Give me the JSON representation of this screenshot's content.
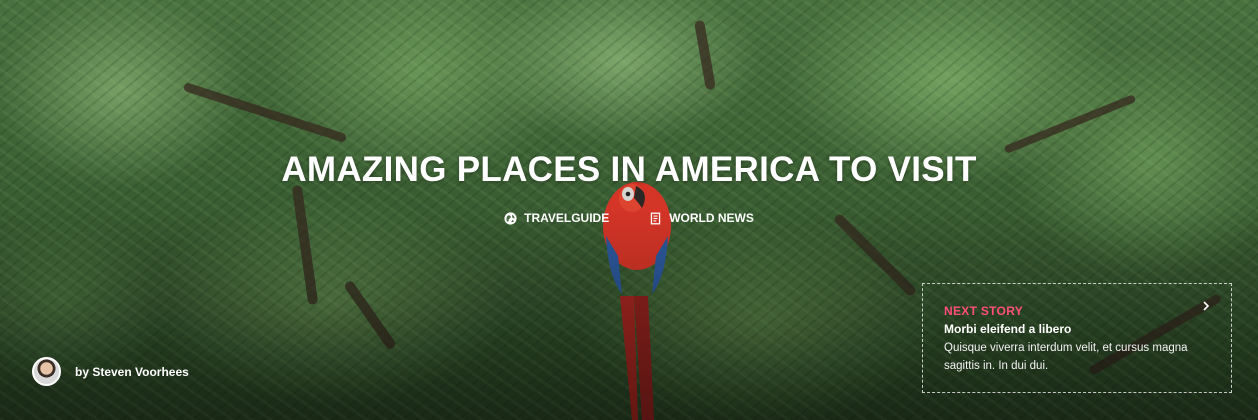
{
  "hero": {
    "title": "AMAZING PLACES IN AMERICA TO VISIT",
    "categories": [
      {
        "label": "TRAVELGUIDE",
        "icon": "globe-icon"
      },
      {
        "label": "WORLD NEWS",
        "icon": "document-icon"
      }
    ]
  },
  "author": {
    "byline": "by Steven Voorhees",
    "avatar_icon": "avatar"
  },
  "next_story": {
    "label": "NEXT STORY",
    "title": "Morbi eleifend a libero",
    "excerpt": "Quisque viverra interdum velit, et cursus magna sagittis in. In dui dui.",
    "arrow_icon": "chevron-right-icon"
  },
  "colors": {
    "accent": "#ff4f7a",
    "text": "#ffffff"
  }
}
